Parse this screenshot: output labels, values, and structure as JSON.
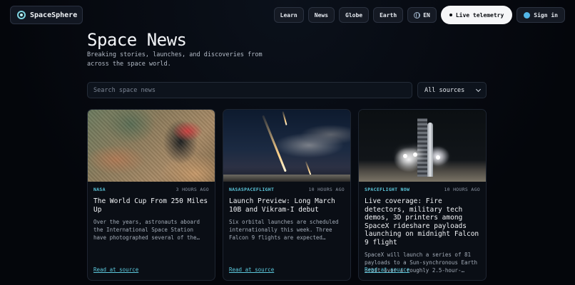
{
  "brand": {
    "name": "SpaceSphere"
  },
  "nav": {
    "items": [
      "Learn",
      "News",
      "Globe",
      "Earth"
    ],
    "language": "EN",
    "telemetry": "Live telemetry",
    "signin": "Sign in"
  },
  "header": {
    "title": "Space News",
    "subtitle": "Breaking stories, launches, and discoveries from across the space world."
  },
  "search": {
    "placeholder": "Search space news",
    "value": ""
  },
  "filter": {
    "selected": "All sources"
  },
  "articles": [
    {
      "source": "NASA",
      "time": "3 HOURS AGO",
      "title": "The World Cup From 250 Miles Up",
      "description": "Over the years, astronauts aboard the International Space Station have photographed several of the cities...",
      "link": "Read at source"
    },
    {
      "source": "NASASPACEFLIGHT",
      "time": "10 HOURS AGO",
      "title": "Launch Preview: Long March 10B and Vikram-I debut",
      "description": "Six orbital launches are scheduled internationally this week. Three Falcon 9 flights are expected from...",
      "link": "Read at source"
    },
    {
      "source": "SPACEFLIGHT NOW",
      "time": "10 HOURS AGO",
      "title": "Live coverage: Fire detectors, military tech demos, 3D printers among SpaceX rideshare payloads launching on midnight Falcon 9 flight",
      "description": "SpaceX will launch a series of 81 payloads to a Sun-synchronous Earth orbit over a roughly 2.5-hour-long...",
      "link": "Read at source"
    }
  ],
  "colors": {
    "accent": "#5cc8dc",
    "background": "#04060b",
    "card": "#0a0e15"
  }
}
